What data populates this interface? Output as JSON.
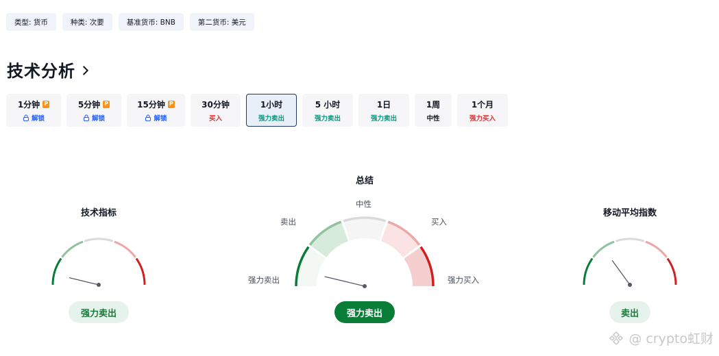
{
  "tags": [
    {
      "label": "类型: 货币"
    },
    {
      "label": "种类: 次要"
    },
    {
      "label": "基准货币: BNB"
    },
    {
      "label": "第二货币: 美元"
    }
  ],
  "section": {
    "title": "技术分析"
  },
  "intervals": [
    {
      "label": "1分钟",
      "status": "解锁",
      "locked": true
    },
    {
      "label": "5分钟",
      "status": "解锁",
      "locked": true
    },
    {
      "label": "15分钟",
      "status": "解锁",
      "locked": true
    },
    {
      "label": "30分钟",
      "status": "买入",
      "locked": false
    },
    {
      "label": "1小时",
      "status": "强力卖出",
      "locked": false,
      "active": true
    },
    {
      "label": "5 小时",
      "status": "强力卖出",
      "locked": false
    },
    {
      "label": "1日",
      "status": "强力卖出",
      "locked": false
    },
    {
      "label": "1周",
      "status": "中性",
      "locked": false
    },
    {
      "label": "1个月",
      "status": "强力买入",
      "locked": false
    }
  ],
  "icons": {
    "pro_badge": "P",
    "lock": "lock-icon",
    "chevron": "chevron-right-icon"
  },
  "gauges": {
    "left": {
      "title": "技术指标",
      "result": "强力卖出",
      "needle_value": -0.85
    },
    "center": {
      "title": "总结",
      "result": "强力卖出",
      "needle_value": -0.85,
      "labels": {
        "neutral": "中性",
        "sell": "卖出",
        "buy": "买入",
        "strong_sell": "强力卖出",
        "strong_buy": "强力买入"
      }
    },
    "right": {
      "title": "移动平均指数",
      "result": "卖出",
      "needle_value": -0.4
    }
  },
  "colors": {
    "strong_sell": "#077d37",
    "sell": "#8fc29e",
    "neutral": "#dadada",
    "buy": "#eca7a7",
    "strong_buy": "#cf1f1f",
    "active_border": "#1e3a5f"
  },
  "watermark": {
    "text": "@ crypto虹财"
  }
}
